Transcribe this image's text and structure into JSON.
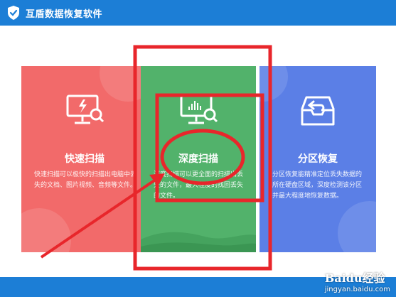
{
  "window": {
    "title": "互盾数据恢复软件"
  },
  "cards": [
    {
      "title": "快速扫描",
      "desc": "快速扫描可以极快的扫描出电脑中丢失的文档、图片视频、音频等文件。"
    },
    {
      "title": "深度扫描",
      "desc": "深度扫描可以更全面的扫描出丢失的文件，最大程度的找回丢失的文件。"
    },
    {
      "title": "分区恢复",
      "desc": "分区恢复能精准定位丢失数据的所在硬盘区域，深度检测该分区并最大程度地恢复数据。"
    }
  ],
  "watermark": {
    "brand": "Baidu经验",
    "url": "jingyan.baidu.com"
  },
  "colors": {
    "titlebar": "#1c7ed6",
    "quick_card": "#f26a6a",
    "deep_card": "#52b26b",
    "partition_card": "#5b7fe6",
    "annotation_red": "#e8262b"
  },
  "icons": {
    "logo": "shield-check-icon",
    "quick": "monitor-search-icon",
    "deep": "monitor-chart-search-icon",
    "partition": "inbox-restore-icon"
  }
}
